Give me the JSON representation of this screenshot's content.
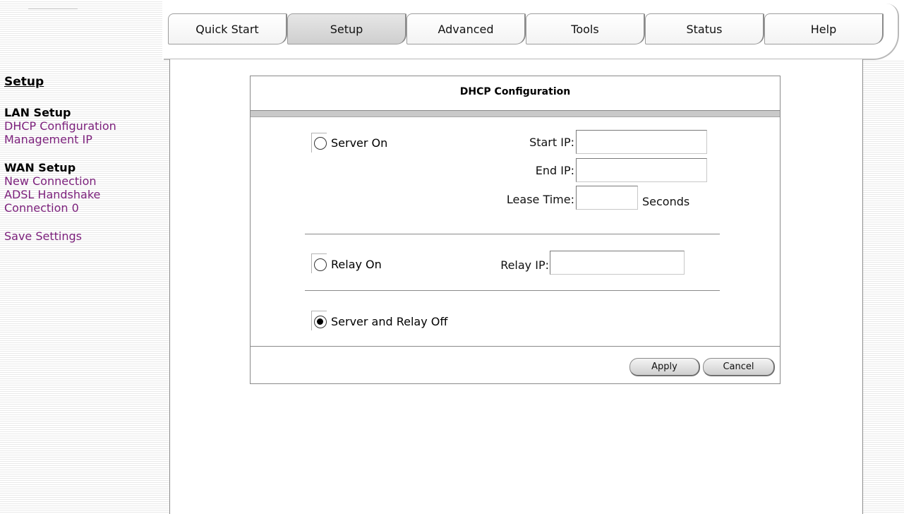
{
  "tabs": [
    {
      "label": "Quick Start",
      "active": false
    },
    {
      "label": "Setup",
      "active": true
    },
    {
      "label": "Advanced",
      "active": false
    },
    {
      "label": "Tools",
      "active": false
    },
    {
      "label": "Status",
      "active": false
    },
    {
      "label": "Help",
      "active": false
    }
  ],
  "sidebar": {
    "title": "Setup",
    "lan_group": "LAN Setup",
    "lan_items": [
      "DHCP Configuration",
      "Management IP"
    ],
    "wan_group": "WAN Setup",
    "wan_items": [
      "New Connection",
      "ADSL Handshake",
      "Connection 0"
    ],
    "save": "Save Settings"
  },
  "dhcp": {
    "title": "DHCP Configuration",
    "server_on_label": "Server On",
    "start_ip_label": "Start IP:",
    "end_ip_label": "End IP:",
    "lease_time_label": "Lease Time:",
    "seconds_label": "Seconds",
    "relay_on_label": "Relay On",
    "relay_ip_label": "Relay IP:",
    "off_label": "Server and Relay Off",
    "start_ip_value": "",
    "end_ip_value": "",
    "lease_time_value": "",
    "relay_ip_value": "",
    "selected": "Server and Relay Off"
  },
  "buttons": {
    "apply": "Apply",
    "cancel": "Cancel"
  },
  "colors": {
    "link": "#7b1f7b",
    "active_tab": "#d6d6d6"
  }
}
